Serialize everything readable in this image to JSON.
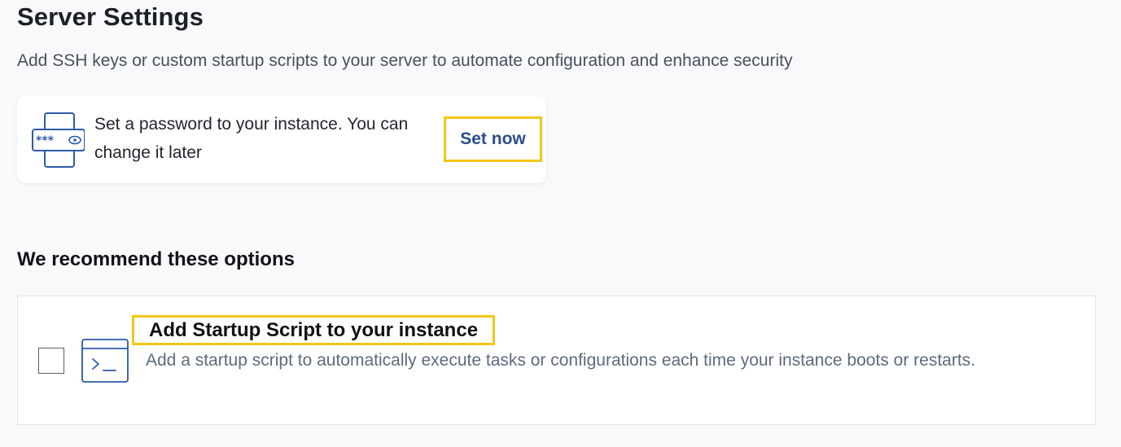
{
  "header": {
    "title": "Server Settings",
    "subtitle": "Add SSH keys or custom startup scripts to your server to automate configuration and enhance security"
  },
  "password_card": {
    "icon": "password-device-icon",
    "text": "Set a password to your instance. You can change it later",
    "button_label": "Set now",
    "button_color": "#2b4c8c",
    "highlight_color": "#f3c617"
  },
  "recommendations": {
    "heading": "We recommend these options",
    "options": [
      {
        "icon": "terminal-icon",
        "title": "Add Startup Script to your instance",
        "description": "Add a startup script to automatically execute tasks or configurations each time your instance boots or restarts.",
        "checked": false
      }
    ]
  },
  "colors": {
    "background": "#f8f9fb",
    "icon_blue": "#2b5aa8",
    "muted_text": "#5d6a7e"
  }
}
